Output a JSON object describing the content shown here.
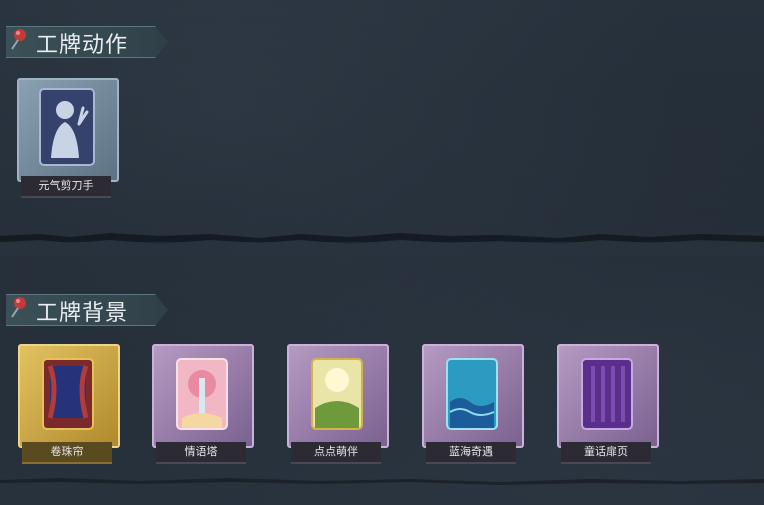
{
  "sections": [
    {
      "title": "工牌动作",
      "items": [
        {
          "label": "元气剪刀手",
          "icon": "scissor-hand-silhouette-card-icon",
          "frame_color": "#6f8396"
        }
      ]
    },
    {
      "title": "工牌背景",
      "items": [
        {
          "label": "卷珠帘",
          "icon": "curtain-card-icon",
          "frame_color": "#c7a440"
        },
        {
          "label": "情语塔",
          "icon": "romance-tower-card-icon",
          "frame_color": "#8c6f9a"
        },
        {
          "label": "点点萌伴",
          "icon": "meadow-companion-card-icon",
          "frame_color": "#8c6f9a"
        },
        {
          "label": "蓝海奇遇",
          "icon": "blue-sea-card-icon",
          "frame_color": "#8c6f9a"
        },
        {
          "label": "童话扉页",
          "icon": "fairytale-page-card-icon",
          "frame_color": "#8c6f9a"
        }
      ]
    }
  ]
}
